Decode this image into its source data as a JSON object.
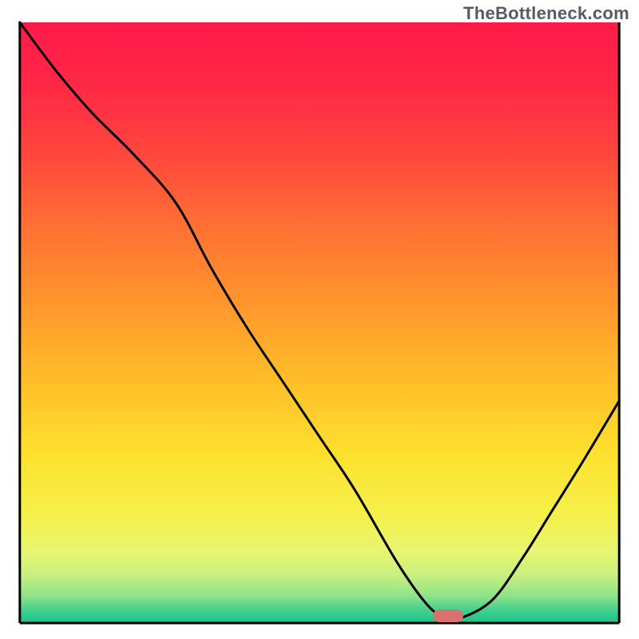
{
  "watermark_text": "TheBottleneck.com",
  "chart_data": {
    "type": "line",
    "title": "",
    "xlabel": "",
    "ylabel": "",
    "xlim": [
      0,
      100
    ],
    "ylim": [
      0,
      100
    ],
    "x": [
      0,
      6,
      12,
      19,
      26,
      32,
      38,
      44,
      50,
      56,
      63,
      68,
      71,
      74,
      79,
      84,
      89,
      94,
      100
    ],
    "y": [
      100,
      92,
      85,
      78,
      70,
      59,
      49,
      40,
      31,
      22,
      10,
      3,
      1,
      1,
      4,
      11,
      19,
      27,
      37
    ],
    "curve_color": "#000000",
    "background_gradient_stops": [
      {
        "offset": 0.0,
        "color": "#ff1a4a"
      },
      {
        "offset": 0.1,
        "color": "#ff2746"
      },
      {
        "offset": 0.22,
        "color": "#ff473d"
      },
      {
        "offset": 0.35,
        "color": "#ff7333"
      },
      {
        "offset": 0.48,
        "color": "#ff9a2c"
      },
      {
        "offset": 0.6,
        "color": "#ffbf28"
      },
      {
        "offset": 0.72,
        "color": "#fde12e"
      },
      {
        "offset": 0.82,
        "color": "#f4f04a"
      },
      {
        "offset": 0.88,
        "color": "#e9f670"
      },
      {
        "offset": 0.92,
        "color": "#c8f07f"
      },
      {
        "offset": 0.955,
        "color": "#8fe389"
      },
      {
        "offset": 0.98,
        "color": "#3fce8e"
      },
      {
        "offset": 1.0,
        "color": "#18c48e"
      }
    ],
    "marker": {
      "x": 71.5,
      "y": 1.2
    },
    "axes": {
      "left": {
        "x1": 3.1,
        "y1": 3.5,
        "x2": 3.1,
        "y2": 97.5
      },
      "bottom": {
        "x1": 3.1,
        "y1": 97.5,
        "x2": 96.9,
        "y2": 97.5
      },
      "right": {
        "x1": 96.9,
        "y1": 3.5,
        "x2": 96.9,
        "y2": 97.5
      }
    }
  }
}
